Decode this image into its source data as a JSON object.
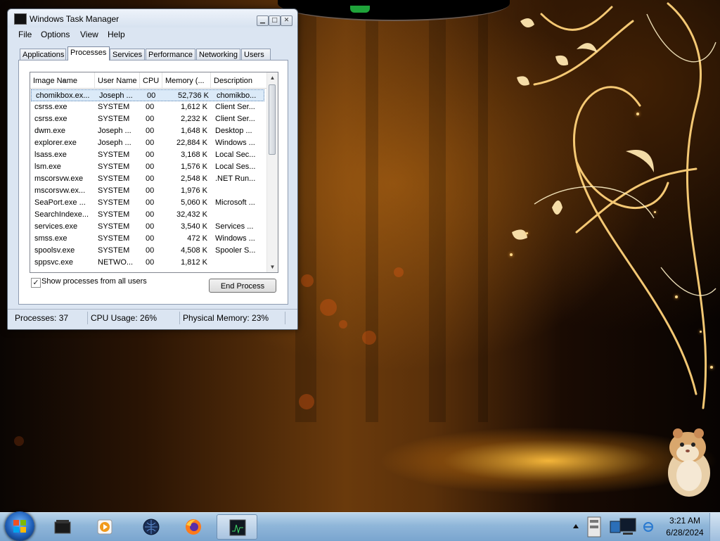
{
  "window": {
    "title": "Windows Task Manager",
    "controls": {
      "minimize": "▁",
      "maximize": "□",
      "close": "✕"
    }
  },
  "menu": [
    "File",
    "Options",
    "View",
    "Help"
  ],
  "tabs": [
    "Applications",
    "Processes",
    "Services",
    "Performance",
    "Networking",
    "Users"
  ],
  "active_tab": "Processes",
  "process_table": {
    "columns": [
      "Image Name",
      "User Name",
      "CPU",
      "Memory (...",
      "Description"
    ],
    "sort_indicator": "▲",
    "rows": [
      {
        "name": "chomikbox.ex...",
        "user": "Joseph ...",
        "cpu": "00",
        "memory": "52,736 K",
        "description": "chomikbo...",
        "selected": true
      },
      {
        "name": "csrss.exe",
        "user": "SYSTEM",
        "cpu": "00",
        "memory": "1,612 K",
        "description": "Client Ser..."
      },
      {
        "name": "csrss.exe",
        "user": "SYSTEM",
        "cpu": "00",
        "memory": "2,232 K",
        "description": "Client Ser..."
      },
      {
        "name": "dwm.exe",
        "user": "Joseph ...",
        "cpu": "00",
        "memory": "1,648 K",
        "description": "Desktop ..."
      },
      {
        "name": "explorer.exe",
        "user": "Joseph ...",
        "cpu": "00",
        "memory": "22,884 K",
        "description": "Windows ..."
      },
      {
        "name": "lsass.exe",
        "user": "SYSTEM",
        "cpu": "00",
        "memory": "3,168 K",
        "description": "Local Sec..."
      },
      {
        "name": "lsm.exe",
        "user": "SYSTEM",
        "cpu": "00",
        "memory": "1,576 K",
        "description": "Local Ses..."
      },
      {
        "name": "mscorsvw.exe",
        "user": "SYSTEM",
        "cpu": "00",
        "memory": "2,548 K",
        "description": ".NET Run..."
      },
      {
        "name": "mscorsvw.ex...",
        "user": "SYSTEM",
        "cpu": "00",
        "memory": "1,976 K",
        "description": ""
      },
      {
        "name": "SeaPort.exe ...",
        "user": "SYSTEM",
        "cpu": "00",
        "memory": "5,060 K",
        "description": "Microsoft ..."
      },
      {
        "name": "SearchIndexe...",
        "user": "SYSTEM",
        "cpu": "00",
        "memory": "32,432 K",
        "description": ""
      },
      {
        "name": "services.exe",
        "user": "SYSTEM",
        "cpu": "00",
        "memory": "3,540 K",
        "description": "Services ..."
      },
      {
        "name": "smss.exe",
        "user": "SYSTEM",
        "cpu": "00",
        "memory": "472 K",
        "description": "Windows ..."
      },
      {
        "name": "spoolsv.exe",
        "user": "SYSTEM",
        "cpu": "00",
        "memory": "4,508 K",
        "description": "Spooler S..."
      },
      {
        "name": "sppsvc.exe",
        "user": "NETWO...",
        "cpu": "00",
        "memory": "1,812 K",
        "description": ""
      }
    ],
    "scroll": {
      "up": "▲",
      "down": "▼"
    }
  },
  "show_all_processes": {
    "label": "Show processes from all users",
    "checked": true,
    "check_glyph": "✓"
  },
  "end_process_label": "End Process",
  "status": {
    "processes": "Processes: 37",
    "cpu_usage": "CPU Usage: 26%",
    "physical_memory": "Physical Memory: 23%"
  },
  "taskbar": {
    "items": [
      "terminal-app-icon",
      "media-player-icon",
      "network-globe-icon",
      "firefox-icon",
      "task-manager-icon"
    ],
    "active_item": "task-manager-icon",
    "clock": {
      "time": "3:21 AM",
      "date": "6/28/2024"
    }
  },
  "colors": {
    "window_bg": "#dbe5f2",
    "selection": "#dbeaf8",
    "taskbar": "#8fb6d9",
    "wallpaper_gold": "#ffc864"
  }
}
